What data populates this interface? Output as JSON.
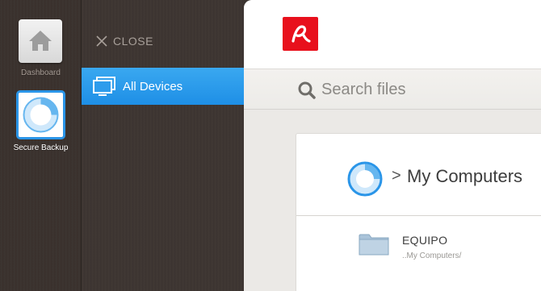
{
  "rail": {
    "apps": [
      {
        "label": "Dashboard",
        "icon": "home-icon"
      },
      {
        "label": "Secure Backup",
        "icon": "backup-icon"
      }
    ]
  },
  "panel": {
    "close_label": "CLOSE",
    "nav_items": [
      {
        "label": "All Devices",
        "icon": "monitor-icon",
        "active": true
      }
    ]
  },
  "header": {
    "logo": "avira-logo-icon",
    "brand_color": "#e8101c"
  },
  "search": {
    "placeholder": "Search files",
    "value": ""
  },
  "content": {
    "breadcrumb_separator": ">",
    "breadcrumb_title": "My Computers",
    "files": [
      {
        "name": "EQUIPO",
        "path": "..My Computers/",
        "icon": "folder-icon"
      }
    ]
  },
  "colors": {
    "accent": "#2a95e8",
    "sidebar_bg": "#3b3430",
    "brand": "#e8101c"
  }
}
